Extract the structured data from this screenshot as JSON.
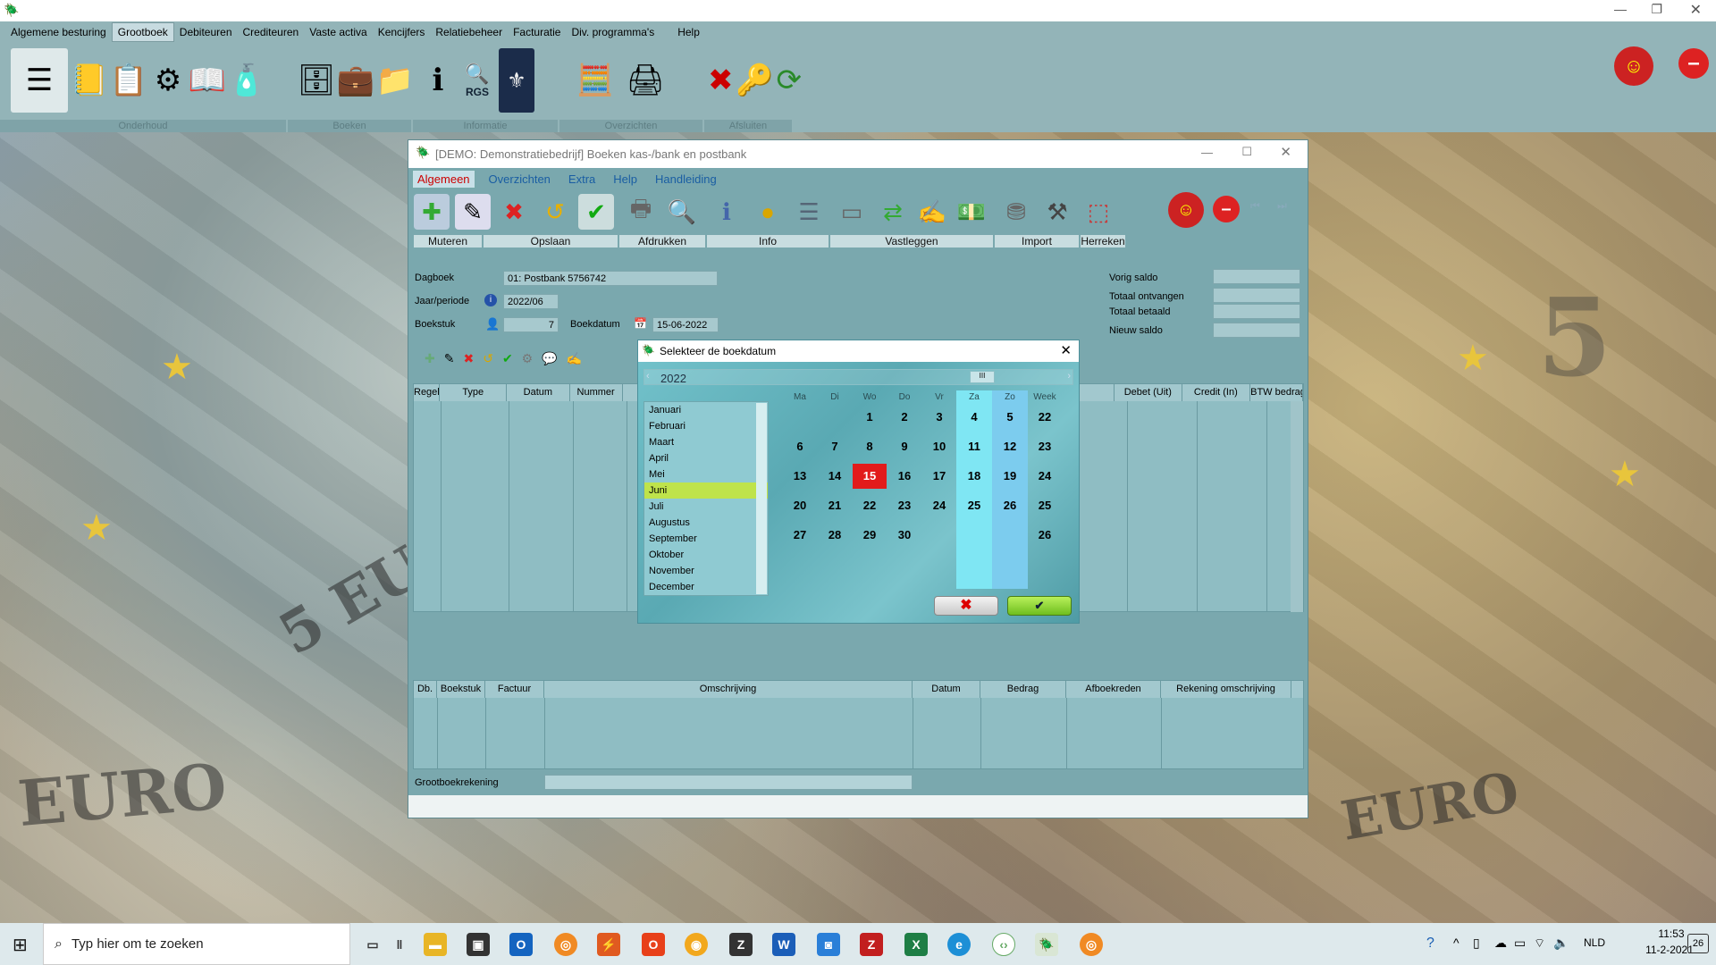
{
  "app": {
    "menu": [
      "Algemene besturing",
      "Grootboek",
      "Debiteuren",
      "Crediteuren",
      "Vaste activa",
      "Kencijfers",
      "Relatiebeheer",
      "Facturatie",
      "Div. programma's",
      "Help"
    ],
    "selected_menu": "Grootboek",
    "toolbar_groups": [
      "Onderhoud",
      "Boeken",
      "Informatie",
      "Overzichten",
      "Afsluiten"
    ],
    "rgs_label": "RGS"
  },
  "window": {
    "title": "[DEMO: Demonstratiebedrijf]  Boeken kas-/bank en postbank",
    "menu": [
      "Algemeen",
      "Overzichten",
      "Extra",
      "Help",
      "Handleiding"
    ],
    "selected_menu": "Algemeen",
    "tool_labels": [
      "Muteren",
      "Opslaan",
      "Afdrukken",
      "Info",
      "Vastleggen",
      "Import",
      "Herreken"
    ],
    "fields": {
      "dagboek_label": "Dagboek",
      "dagboek_value": "01: Postbank 5756742",
      "periode_label": "Jaar/periode",
      "periode_value": "2022/06",
      "boekstuk_label": "Boekstuk",
      "boekstuk_value": "7",
      "boekdatum_label": "Boekdatum",
      "boekdatum_value": "15-06-2022",
      "vorig_saldo": "Vorig saldo",
      "totaal_ontvangen": "Totaal ontvangen",
      "totaal_betaald": "Totaal betaald",
      "nieuw_saldo": "Nieuw saldo"
    },
    "grid1_headers": [
      "Regel",
      "Type",
      "Datum",
      "Nummer",
      "Debet (Uit)",
      "Credit (In)",
      "BTW bedrag"
    ],
    "grid2_headers": [
      "Db.",
      "Boekstuk",
      "Factuur",
      "Omschrijving",
      "Datum",
      "Bedrag",
      "Afboekreden",
      "Rekening omschrijving"
    ],
    "grootboek_label": "Grootboekrekening"
  },
  "dialog": {
    "title": "Selekteer de boekdatum",
    "year": "2022",
    "months": [
      "Januari",
      "Februari",
      "Maart",
      "April",
      "Mei",
      "Juni",
      "Juli",
      "Augustus",
      "September",
      "Oktober",
      "November",
      "December"
    ],
    "selected_month": "Juni",
    "day_headers": [
      "Ma",
      "Di",
      "Wo",
      "Do",
      "Vr",
      "Za",
      "Zo",
      "Week"
    ],
    "weeks": [
      {
        "days": [
          "",
          "",
          "1",
          "2",
          "3",
          "4",
          "5"
        ],
        "week": "22"
      },
      {
        "days": [
          "6",
          "7",
          "8",
          "9",
          "10",
          "11",
          "12"
        ],
        "week": "23"
      },
      {
        "days": [
          "13",
          "14",
          "15",
          "16",
          "17",
          "18",
          "19"
        ],
        "week": "24"
      },
      {
        "days": [
          "20",
          "21",
          "22",
          "23",
          "24",
          "25",
          "26"
        ],
        "week": "25"
      },
      {
        "days": [
          "27",
          "28",
          "29",
          "30",
          "",
          "",
          ""
        ],
        "week": "26"
      }
    ],
    "selected_day": "15"
  },
  "taskbar": {
    "search_placeholder": "Typ hier om te zoeken",
    "lang": "NLD",
    "time": "11:53",
    "date": "11-2-2021",
    "notifications": "26"
  }
}
